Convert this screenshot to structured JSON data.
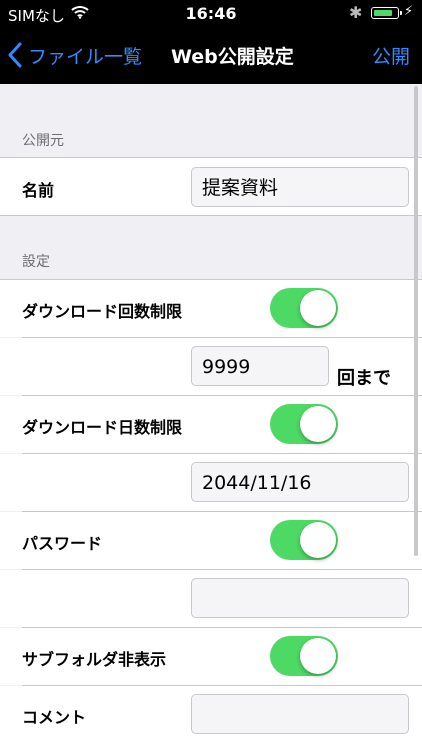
{
  "status_bar": {
    "carrier": "SIMなし",
    "time": "16:46",
    "battery_level": 0.85
  },
  "nav": {
    "back_label": "ファイル一覧",
    "title": "Web公開設定",
    "action_label": "公開"
  },
  "sections": {
    "source": {
      "header": "公開元",
      "name_label": "名前",
      "name_value": "提案資料"
    },
    "settings": {
      "header": "設定",
      "download_count": {
        "label": "ダウンロード回数制限",
        "enabled": true,
        "value": "9999",
        "suffix": "回まで"
      },
      "download_days": {
        "label": "ダウンロード日数制限",
        "enabled": true,
        "value": "2044/11/16"
      },
      "password": {
        "label": "パスワード",
        "enabled": true,
        "value": ""
      },
      "hide_subfolders": {
        "label": "サブフォルダ非表示",
        "enabled": true
      },
      "comment": {
        "label": "コメント",
        "value": ""
      }
    }
  },
  "colors": {
    "accent": "#2f8bff",
    "toggle_on": "#4cd964",
    "background": "#efeff4",
    "header_text": "#6d6d72"
  }
}
